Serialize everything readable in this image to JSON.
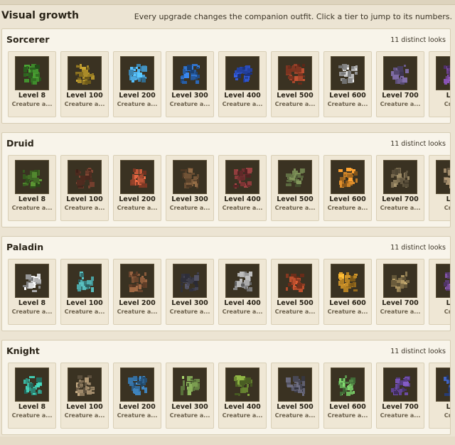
{
  "header": {
    "title": "Visual growth",
    "hint": "Every upgrade changes the companion outfit. Click a tier to jump to its numbers."
  },
  "vocations": [
    {
      "name": "Sorcerer",
      "count_label": "11 distinct looks",
      "tiers": [
        {
          "level": "Level 8",
          "caption": "Creature a...",
          "icon": "small-green-creature-sprite",
          "color": "#3f8a2c"
        },
        {
          "level": "Level 100",
          "caption": "Creature a...",
          "icon": "golden-serpent-sprite",
          "color": "#b0902a"
        },
        {
          "level": "Level 200",
          "caption": "Creature a...",
          "icon": "blue-orb-mage-sprite",
          "color": "#4aa3d8"
        },
        {
          "level": "Level 300",
          "caption": "Creature a...",
          "icon": "blue-scorpion-sprite",
          "color": "#2f6fc4"
        },
        {
          "level": "Level 400",
          "caption": "Creature a...",
          "icon": "blue-lightning-beast-sprite",
          "color": "#2c4fc0"
        },
        {
          "level": "Level 500",
          "caption": "Creature a...",
          "icon": "red-spider-sprite",
          "color": "#a0442a"
        },
        {
          "level": "Level 600",
          "caption": "Creature a...",
          "icon": "white-spirit-sprite",
          "color": "#c8c8c8"
        },
        {
          "level": "Level 700",
          "caption": "Creature a...",
          "icon": "armored-warbeast-sprite",
          "color": "#6a5a8a"
        },
        {
          "level": "Lev",
          "caption": "Creat",
          "icon": "purple-beast-sprite",
          "color": "#7a4aa0"
        }
      ]
    },
    {
      "name": "Druid",
      "count_label": "11 distinct looks",
      "tiers": [
        {
          "level": "Level 8",
          "caption": "Creature a...",
          "icon": "green-lizard-sprite",
          "color": "#4a7a2a"
        },
        {
          "level": "Level 100",
          "caption": "Creature a...",
          "icon": "small-brown-beast-sprite",
          "color": "#6a3a2a"
        },
        {
          "level": "Level 200",
          "caption": "Creature a...",
          "icon": "red-serpent-sprite",
          "color": "#c85a3a"
        },
        {
          "level": "Level 300",
          "caption": "Creature a...",
          "icon": "small-brown-bug-sprite",
          "color": "#7a5a3a"
        },
        {
          "level": "Level 400",
          "caption": "Creature a...",
          "icon": "dark-red-scorpion-sprite",
          "color": "#8a3a3a"
        },
        {
          "level": "Level 500",
          "caption": "Creature a...",
          "icon": "swamp-creature-sprite",
          "color": "#6a7a4a"
        },
        {
          "level": "Level 600",
          "caption": "Creature a...",
          "icon": "fire-wing-beast-sprite",
          "color": "#d88a2a"
        },
        {
          "level": "Level 700",
          "caption": "Creature a...",
          "icon": "bog-golem-sprite",
          "color": "#8a7a5a"
        },
        {
          "level": "Lev",
          "caption": "Creat",
          "icon": "tan-beast-sprite",
          "color": "#a08a6a"
        }
      ]
    },
    {
      "name": "Paladin",
      "count_label": "11 distinct looks",
      "tiers": [
        {
          "level": "Level 8",
          "caption": "Creature a...",
          "icon": "white-sheep-sprite",
          "color": "#d8d8d8"
        },
        {
          "level": "Level 100",
          "caption": "Creature a...",
          "icon": "teal-moth-sprite",
          "color": "#4aa0a0"
        },
        {
          "level": "Level 200",
          "caption": "Creature a...",
          "icon": "brown-bird-sprite",
          "color": "#8a5a3a"
        },
        {
          "level": "Level 300",
          "caption": "Creature a...",
          "icon": "dark-bat-sprite",
          "color": "#4a4a5a"
        },
        {
          "level": "Level 400",
          "caption": "Creature a...",
          "icon": "grey-owl-sprite",
          "color": "#a0a0a0"
        },
        {
          "level": "Level 500",
          "caption": "Creature a...",
          "icon": "red-cobra-sprite",
          "color": "#b04a2a"
        },
        {
          "level": "Level 600",
          "caption": "Creature a...",
          "icon": "orange-wasp-sprite",
          "color": "#d89a2a"
        },
        {
          "level": "Level 700",
          "caption": "Creature a...",
          "icon": "stone-toad-sprite",
          "color": "#a08a5a"
        },
        {
          "level": "Lev",
          "caption": "Creat",
          "icon": "violet-beast-sprite",
          "color": "#8a5ab0"
        }
      ]
    },
    {
      "name": "Knight",
      "count_label": "11 distinct looks",
      "tiers": [
        {
          "level": "Level 8",
          "caption": "Creature a...",
          "icon": "teal-slime-sprite",
          "color": "#3ab09a"
        },
        {
          "level": "Level 100",
          "caption": "Creature a...",
          "icon": "tan-bear-sprite",
          "color": "#a08a6a"
        },
        {
          "level": "Level 200",
          "caption": "Creature a...",
          "icon": "blue-imp-sprite",
          "color": "#3a7ab0"
        },
        {
          "level": "Level 300",
          "caption": "Creature a...",
          "icon": "green-unicorn-sprite",
          "color": "#8ab05a"
        },
        {
          "level": "Level 400",
          "caption": "Creature a...",
          "icon": "green-orc-sprite",
          "color": "#7a9a3a"
        },
        {
          "level": "Level 500",
          "caption": "Creature a...",
          "icon": "black-spider-sprite",
          "color": "#5a5a6a"
        },
        {
          "level": "Level 600",
          "caption": "Creature a...",
          "icon": "green-dragon-sprite",
          "color": "#6ab05a"
        },
        {
          "level": "Level 700",
          "caption": "Creature a...",
          "icon": "purple-armor-sprite",
          "color": "#6a4aa0"
        },
        {
          "level": "Lev",
          "caption": "Creat",
          "icon": "blue-knight-beast-sprite",
          "color": "#3a5ab0"
        }
      ]
    }
  ]
}
